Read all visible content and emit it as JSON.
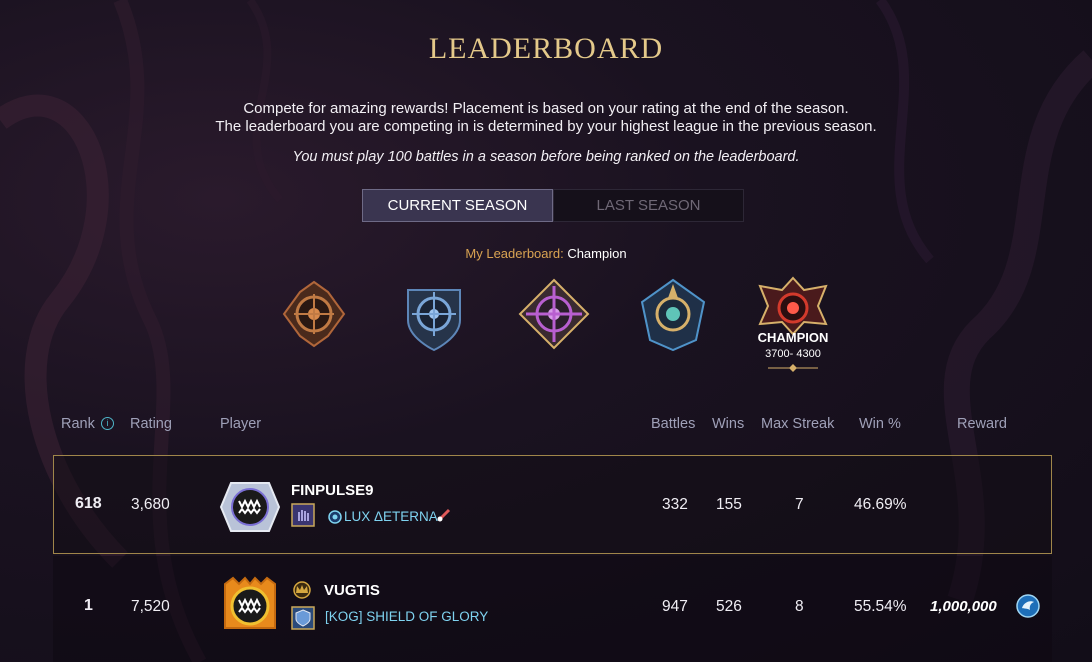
{
  "page": {
    "title": "LEADERBOARD",
    "intro_line1": "Compete for amazing rewards! Placement is based on your rating at the end of the season.",
    "intro_line2": "The leaderboard you are competing in is determined by your highest league in the previous season.",
    "note": "You must play 100 battles in a season before being ranked on the leaderboard."
  },
  "tabs": [
    {
      "label": "CURRENT SEASON",
      "active": true
    },
    {
      "label": "LAST SEASON",
      "active": false
    }
  ],
  "my_leaderboard": {
    "label": "My Leaderboard:",
    "value": "Champion"
  },
  "leagues": [
    {
      "icon": "bronze-league-badge-icon",
      "color": "#b0663a"
    },
    {
      "icon": "silver-league-badge-icon",
      "color": "#5d86b8"
    },
    {
      "icon": "gold-league-badge-icon",
      "color": "#b85fd0"
    },
    {
      "icon": "diamond-league-badge-icon",
      "color": "#4f93c9"
    },
    {
      "icon": "champion-league-badge-icon",
      "color": "#d33a2c",
      "name": "CHAMPION",
      "range": "3700- 4300",
      "selected": true
    }
  ],
  "table": {
    "headers": {
      "rank": "Rank",
      "rating": "Rating",
      "player": "Player",
      "battles": "Battles",
      "wins": "Wins",
      "max_streak": "Max Streak",
      "win_pct": "Win %",
      "reward": "Reward"
    },
    "rows": [
      {
        "rank": "618",
        "rating": "3,680",
        "player": "FINPULSE9",
        "guild": "LUX ΔETERNA",
        "battles": "332",
        "wins": "155",
        "max_streak": "7",
        "win_pct": "46.69%",
        "reward": "",
        "highlighted": true
      },
      {
        "rank": "1",
        "rating": "7,520",
        "player": "VUGTIS",
        "guild": "[KOG] SHIELD OF GLORY",
        "battles": "947",
        "wins": "526",
        "max_streak": "8",
        "win_pct": "55.54%",
        "reward": "1,000,000",
        "highlighted": false
      }
    ]
  },
  "colors": {
    "gold_accent": "#e4c98a",
    "guild_text": "#7fd3f0",
    "header_text": "#9fa0b8",
    "highlight_border": "#a0864a"
  }
}
